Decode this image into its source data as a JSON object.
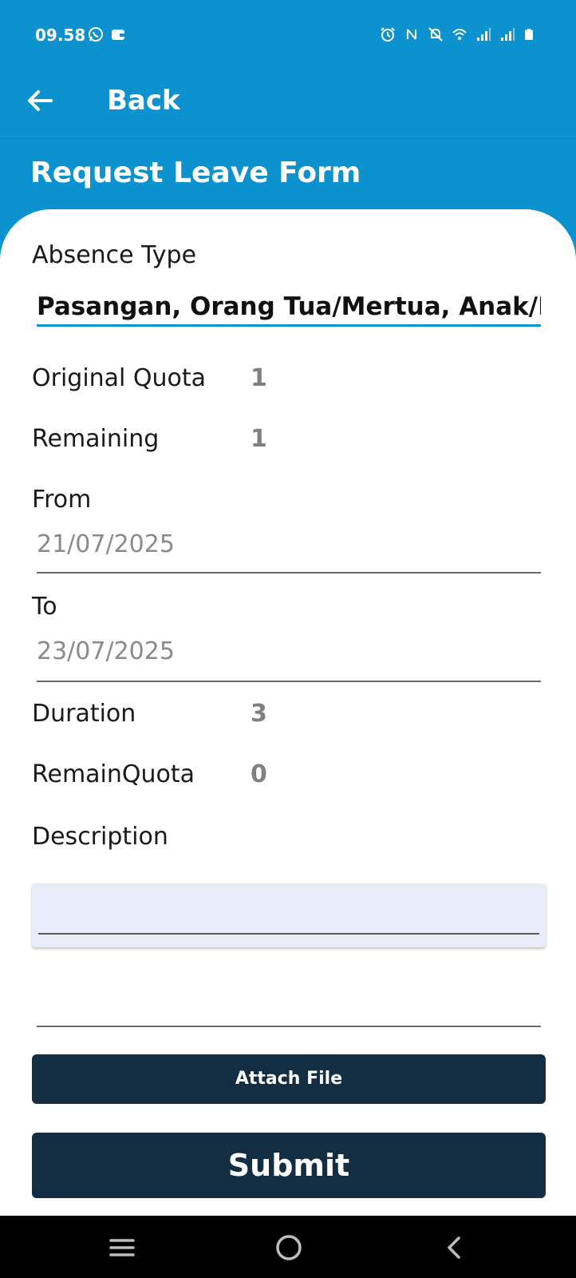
{
  "status_bar": {
    "time": "09.58",
    "left_icons": [
      "whatsapp-icon",
      "wallet-icon"
    ],
    "right_icons": [
      "alarm-icon",
      "nfc-icon",
      "mute-icon",
      "wifi-icon",
      "signal-icon",
      "signal-icon",
      "battery-icon"
    ]
  },
  "app_bar": {
    "back_label": "Back"
  },
  "form": {
    "title": "Request Leave Form",
    "absence_type_label": "Absence Type",
    "absence_type_value": "Pasangan, Orang Tua/Mertua, Anak/Mertua",
    "original_quota_label": "Original Quota",
    "original_quota_value": "1",
    "remaining_label": "Remaining",
    "remaining_value": "1",
    "from_label": "From",
    "from_value": "21/07/2025",
    "to_label": "To",
    "to_value": "23/07/2025",
    "duration_label": "Duration",
    "duration_value": "3",
    "remain_quota_label": "RemainQuota",
    "remain_quota_value": "0",
    "description_label": "Description",
    "description_value": "",
    "attach_label": "Attach File",
    "submit_label": "Submit"
  },
  "nav": {
    "icons": [
      "menu-icon",
      "home-icon",
      "back-icon"
    ]
  },
  "colors": {
    "primary": "#0b92cf",
    "button": "#132d43",
    "desc_bg": "#e8ebf8"
  }
}
